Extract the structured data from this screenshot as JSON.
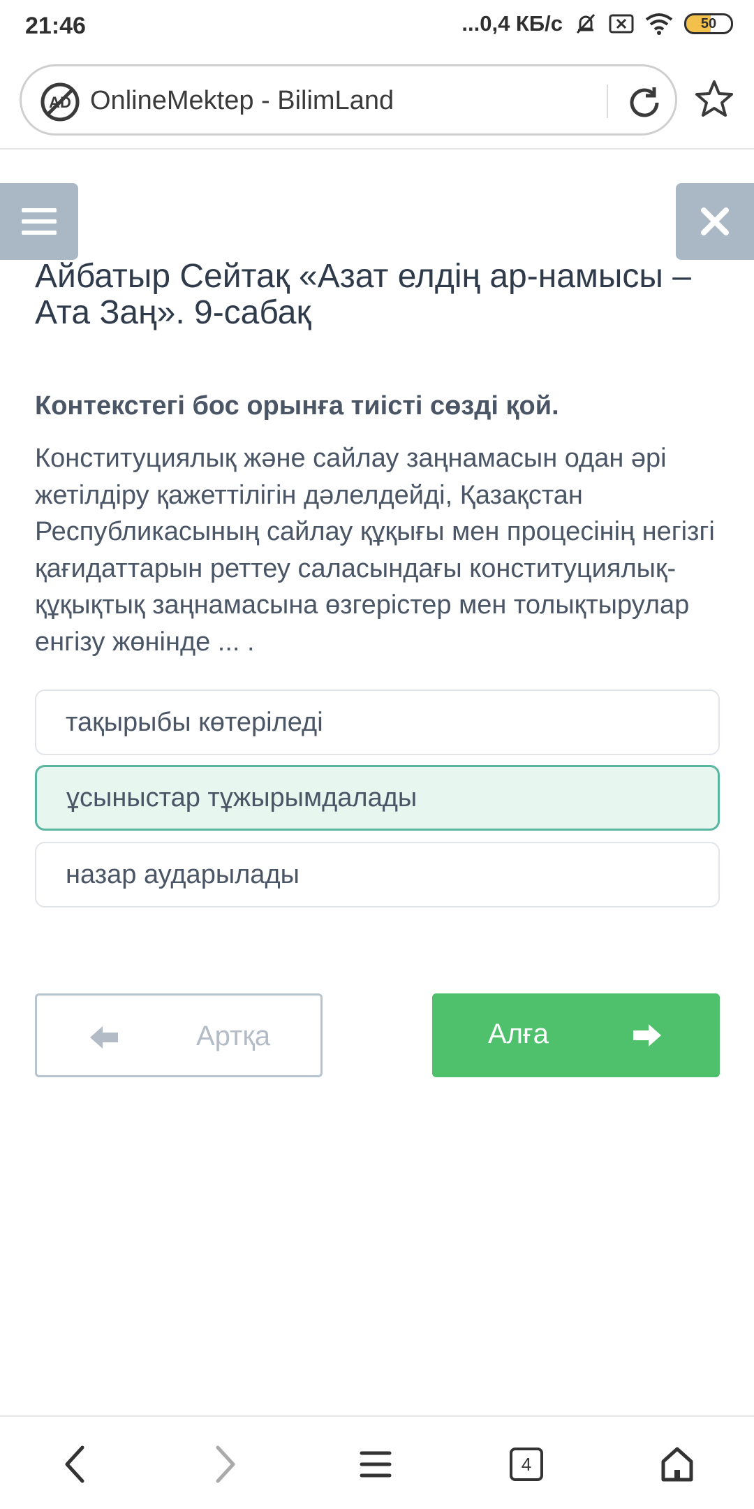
{
  "status_bar": {
    "time": "21:46",
    "network_speed": "...0,4 КБ/с",
    "battery": "50",
    "icons": [
      "mute-bell-icon",
      "sim-x-icon",
      "wifi-icon",
      "battery-icon"
    ]
  },
  "browser": {
    "url_title": "OnlineMektep - BilimLand",
    "icons": [
      "adblock-icon",
      "reload-icon",
      "star-icon"
    ]
  },
  "lesson": {
    "title": "Айбатыр Сейтақ «Азат елдің ар-намысы – Ата Заң». 9-сабақ"
  },
  "question": {
    "heading": "Контекстегі бос орынға тиісті сөзді қой.",
    "body": "Конституциялық және сайлау заңнамасын одан әрі жетілдіру қажеттілігін дәлелдейді, Қазақстан Республикасының сайлау құқығы мен процесінің негізгі қағидаттарын реттеу саласындағы конституциялық-құқықтық заңнамасына өзгерістер мен толықтырулар енгізу жөнінде ... ."
  },
  "options": [
    {
      "label": "тақырыбы көтеріледі",
      "selected": false
    },
    {
      "label": "ұсыныстар тұжырымдалады",
      "selected": true
    },
    {
      "label": "назар аударылады",
      "selected": false
    }
  ],
  "navigation": {
    "back_label": "Артқа",
    "next_label": "Алға"
  },
  "bottom_nav": {
    "tabs_count": "4",
    "icons": [
      "back-arrow-icon",
      "forward-arrow-icon",
      "menu-icon",
      "tabs-icon",
      "home-icon"
    ]
  },
  "colors": {
    "accent_green": "#4fc06c",
    "selected_border": "#58b5a0",
    "selected_bg": "#e8f6f0",
    "side_button": "#a9b8c4"
  }
}
